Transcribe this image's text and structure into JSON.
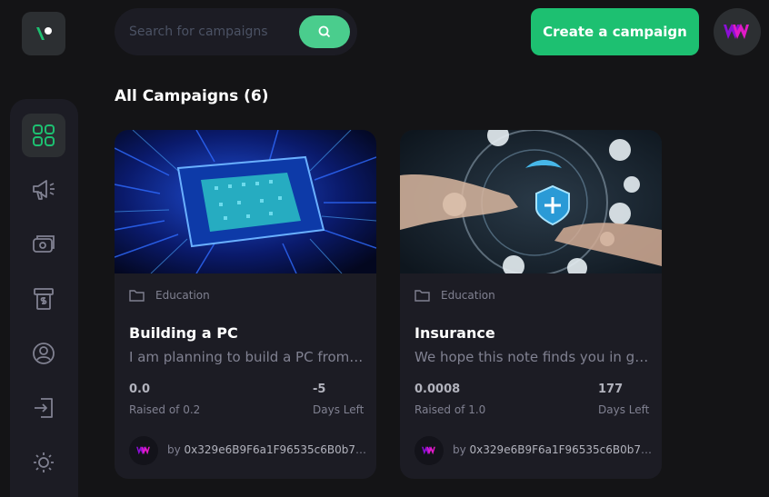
{
  "colors": {
    "accent": "#1dc071",
    "search_button": "#4acd8d",
    "background": "#141416",
    "card": "#1c1c24",
    "brand_pink": "#e11ac8",
    "muted_text": "#808191"
  },
  "header": {
    "search_placeholder": "Search for campaigns",
    "create_label": "Create a campaign"
  },
  "sidebar": {
    "items": [
      {
        "icon": "dashboard-icon",
        "active": true
      },
      {
        "icon": "campaign-megaphone-icon",
        "active": false
      },
      {
        "icon": "payment-icon",
        "active": false
      },
      {
        "icon": "withdraw-icon",
        "active": false
      },
      {
        "icon": "profile-icon",
        "active": false
      },
      {
        "icon": "logout-icon",
        "active": false
      },
      {
        "icon": "sun-icon",
        "active": false
      }
    ]
  },
  "main": {
    "title": "All Campaigns (6)"
  },
  "campaigns": [
    {
      "category": "Education",
      "title": "Building a PC",
      "description": "I am planning to build a PC from scratch for my studies",
      "raised": "0.0",
      "raised_label": "Raised of 0.2",
      "days": "-5",
      "days_label": "Days Left",
      "owner_prefix": "by ",
      "owner": "0x329e6B9F6a1F96535c6B0b7B6..."
    },
    {
      "category": "Education",
      "title": "Insurance",
      "description": "We hope this note finds you in good health",
      "raised": "0.0008",
      "raised_label": "Raised of 1.0",
      "days": "177",
      "days_label": "Days Left",
      "owner_prefix": "by ",
      "owner": "0x329e6B9F6a1F96535c6B0b7B6..."
    }
  ]
}
